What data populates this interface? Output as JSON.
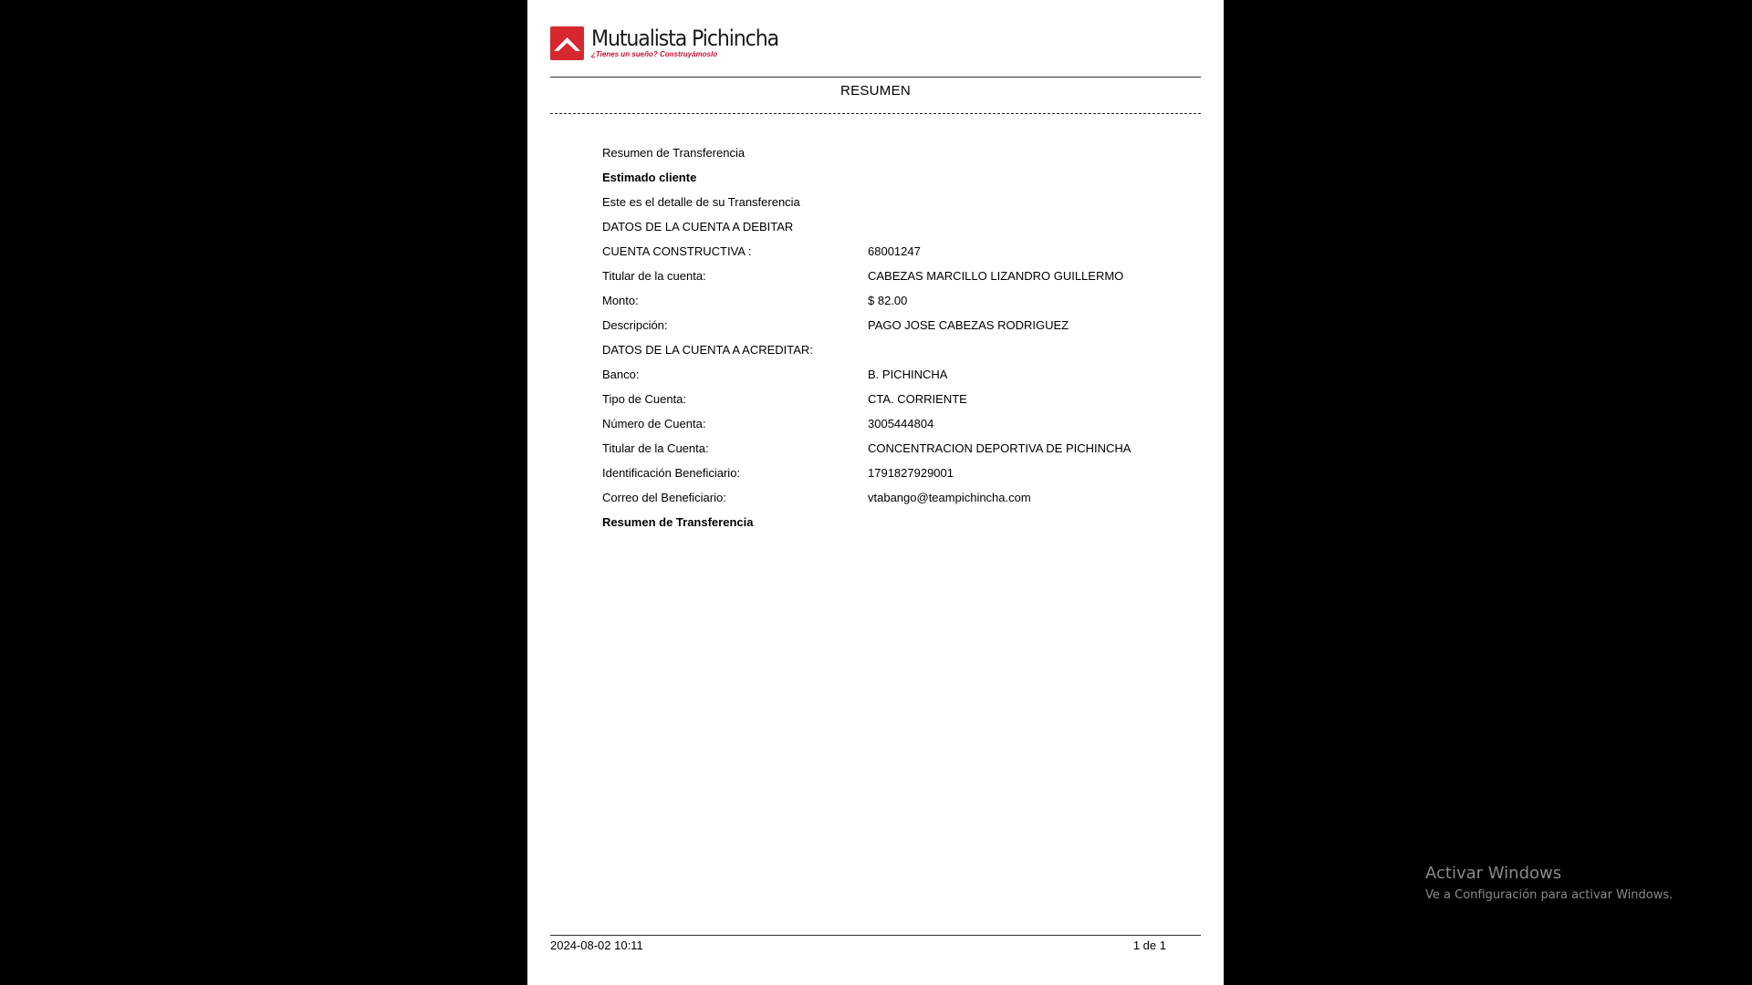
{
  "header": {
    "brand_name": "Mutualista Pichincha",
    "brand_slogan": "¿Tienes un sueño? Construyámoslo",
    "brand_color": "#c8102e"
  },
  "document": {
    "title": "RESUMEN",
    "intro": {
      "heading": "Resumen  de Transferencia",
      "greeting": "Estimado cliente",
      "message": "Este es el detalle de su Transferencia"
    },
    "debit_section": {
      "title": "DATOS DE LA CUENTA A DEBITAR",
      "fields": [
        {
          "label": "CUENTA CONSTRUCTIVA :",
          "value": "68001247"
        },
        {
          "label": "Titular de la cuenta:",
          "value": "CABEZAS MARCILLO LIZANDRO GUILLERMO"
        },
        {
          "label": "Monto:",
          "value": "$ 82.00"
        },
        {
          "label": "Descripción:",
          "value": "PAGO JOSE CABEZAS RODRIGUEZ"
        }
      ]
    },
    "credit_section": {
      "title": "DATOS DE LA CUENTA A ACREDITAR:",
      "fields": [
        {
          "label": "Banco:",
          "value": "B. PICHINCHA"
        },
        {
          "label": "Tipo de Cuenta:",
          "value": "CTA. CORRIENTE"
        },
        {
          "label": "Número de Cuenta:",
          "value": "3005444804"
        },
        {
          "label": "Titular de la Cuenta:",
          "value": "CONCENTRACION DEPORTIVA DE PICHINCHA"
        },
        {
          "label": "Identificación Beneficiario:",
          "value": "1791827929001"
        },
        {
          "label": "Correo del Beneficiario:",
          "value": "vtabango@teampichincha.com"
        }
      ]
    },
    "closing": "Resumen de Transferencia"
  },
  "footer": {
    "timestamp": "2024-08-02 10:11",
    "page_indicator": "1 de 1"
  },
  "windows_watermark": {
    "title": "Activar Windows",
    "subtitle": "Ve a Configuración para activar Windows."
  }
}
